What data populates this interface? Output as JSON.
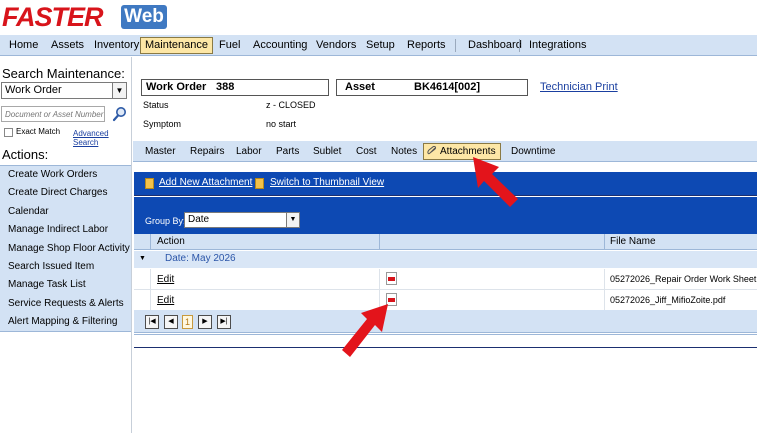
{
  "logo": {
    "faster": "FASTER",
    "web": "Web"
  },
  "nav": {
    "items": [
      {
        "label": "Home"
      },
      {
        "label": "Assets"
      },
      {
        "label": "Inventory"
      },
      {
        "label": "Maintenance",
        "active": true
      },
      {
        "label": "Fuel"
      },
      {
        "label": "Accounting"
      },
      {
        "label": "Vendors"
      },
      {
        "label": "Setup"
      },
      {
        "label": "Reports"
      },
      {
        "label": "Dashboard"
      },
      {
        "label": "Integrations"
      }
    ]
  },
  "search": {
    "title": "Search Maintenance:",
    "selected": "Work Order",
    "placeholder": "Document or Asset Number",
    "exact_match_label": "Exact Match",
    "advanced_link": "Advanced Search"
  },
  "actions": {
    "title": "Actions:",
    "items": [
      "Create Work Orders",
      "Create Direct Charges",
      "Calendar",
      "Manage Indirect Labor",
      "Manage Shop Floor Activity",
      "Search Issued Item",
      "Manage Task List",
      "Service Requests & Alerts",
      "Alert Mapping & Filtering"
    ]
  },
  "header": {
    "work_order_label": "Work Order",
    "work_order_value": "388",
    "asset_label": "Asset",
    "asset_value": "BK4614[002]",
    "technician_print": "Technician Print",
    "status_label": "Status",
    "status_value": "z - CLOSED",
    "symptom_label": "Symptom",
    "symptom_value": "no start"
  },
  "tabs": [
    {
      "label": "Master"
    },
    {
      "label": "Repairs"
    },
    {
      "label": "Labor"
    },
    {
      "label": "Parts"
    },
    {
      "label": "Sublet"
    },
    {
      "label": "Cost"
    },
    {
      "label": "Notes"
    },
    {
      "label": "Attachments",
      "active": true
    },
    {
      "label": "Downtime"
    }
  ],
  "attachments": {
    "add_new": "Add New Attachment",
    "switch_view": "Switch to Thumbnail View",
    "group_by_label": "Group By:",
    "group_by_value": "Date",
    "columns": {
      "action": "Action",
      "file_name": "File Name"
    },
    "group_header": "Date: May 2026",
    "rows": [
      {
        "action": "Edit",
        "file": "05272026_Repair Order Work Sheet."
      },
      {
        "action": "Edit",
        "file": "05272026_Jiff_MifioZoite.pdf"
      }
    ],
    "pager": {
      "current_page": "1"
    }
  },
  "colors": {
    "nav_bg": "#d3e2f4",
    "active_tab": "#fde7a6",
    "toolbar_blue": "#0d49b3",
    "logo_red": "#d8141b",
    "logo_blue": "#3f79c2",
    "arrow_red": "#e3141b"
  }
}
